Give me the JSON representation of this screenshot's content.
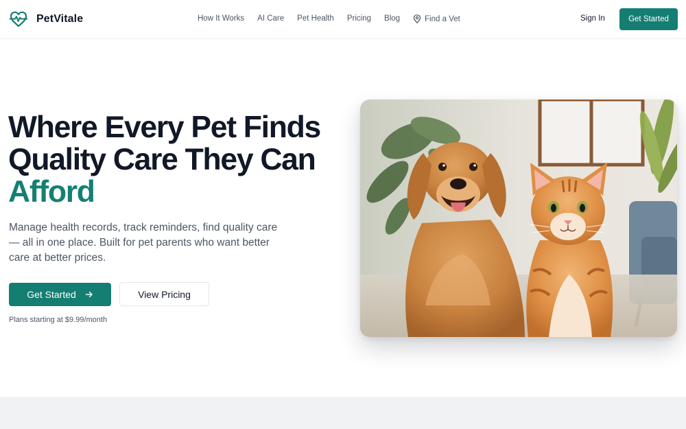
{
  "brand": {
    "name": "PetVitale",
    "accent": "#147e73",
    "logo_icon": "heart-pulse-icon"
  },
  "nav": {
    "links": [
      "How It Works",
      "AI Care",
      "Pet Health",
      "Pricing",
      "Blog"
    ],
    "find_vet": {
      "label": "Find a Vet",
      "icon": "map-pin-icon"
    },
    "sign_in": "Sign In",
    "cta": "Get Started"
  },
  "hero": {
    "headline_line1": "Where Every Pet Finds",
    "headline_line2": "Quality Care They Can",
    "headline_accent": "Afford",
    "subtitle": "Manage health records, track reminders, find quality care — all in one place. Built for pet parents who want better care at better prices.",
    "primary_cta": {
      "label": "Get Started",
      "icon": "arrow-right-icon"
    },
    "secondary_cta": "View Pricing",
    "plans_note": "Plans starting at $9.99/month",
    "image": "golden retriever dog and orange tabby cat photo"
  }
}
